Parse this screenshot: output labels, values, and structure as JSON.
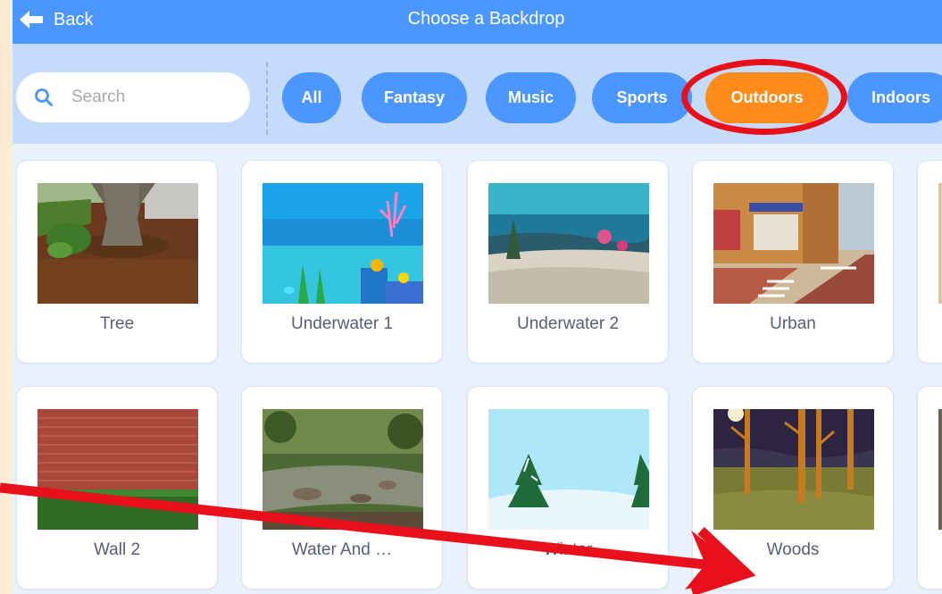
{
  "header": {
    "back_label": "Back",
    "title": "Choose a Backdrop"
  },
  "search": {
    "placeholder": "Search"
  },
  "tags": [
    {
      "label": "All",
      "active": false
    },
    {
      "label": "Fantasy",
      "active": false
    },
    {
      "label": "Music",
      "active": false
    },
    {
      "label": "Sports",
      "active": false
    },
    {
      "label": "Outdoors",
      "active": true
    },
    {
      "label": "Indoors",
      "active": false
    }
  ],
  "backdrops": [
    {
      "name": "Tree"
    },
    {
      "name": "Underwater 1"
    },
    {
      "name": "Underwater 2"
    },
    {
      "name": "Urban"
    },
    {
      "name": "Wall 2"
    },
    {
      "name": "Water And …"
    },
    {
      "name": "Winter"
    },
    {
      "name": "Woods"
    }
  ],
  "colors": {
    "primary": "#4c97ff",
    "active_tag": "#ff8c1a",
    "annotation": "#e8101b",
    "filter_bar": "#c5dbfb",
    "canvas": "#e9f1fc"
  }
}
